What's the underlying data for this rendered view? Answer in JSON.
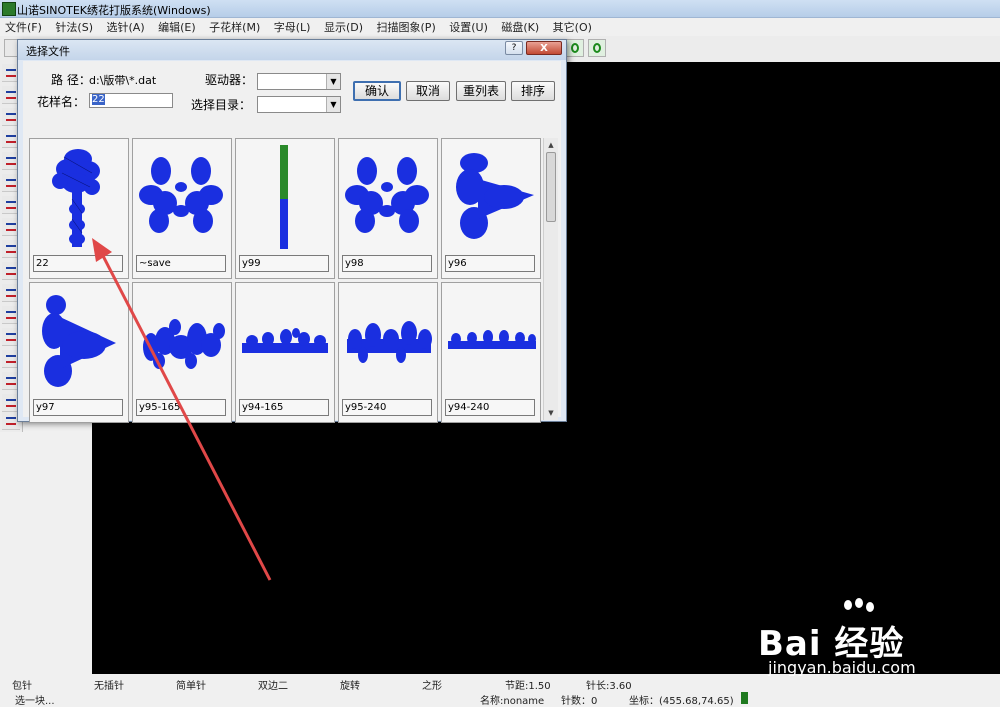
{
  "window": {
    "title": "山诺SINOTEK绣花打版系统(Windows)"
  },
  "menu": [
    "文件(F)",
    "针法(S)",
    "选针(A)",
    "编辑(E)",
    "子花样(M)",
    "字母(L)",
    "显示(D)",
    "扫描图象(P)",
    "设置(U)",
    "磁盘(K)",
    "其它(O)"
  ],
  "dialog": {
    "title": "选择文件",
    "help_label": "?",
    "close_label": "X",
    "path_label": "路 径：",
    "path_value": "d:\\版带\\*.dat",
    "name_label": "花样名：",
    "name_value": "22",
    "drive_label": "驱动器：",
    "dir_label": "选择目录：",
    "buttons": {
      "ok": "确认",
      "cancel": "取消",
      "relist": "重列表",
      "sort": "排序"
    },
    "files": [
      "22",
      "~save",
      "y99",
      "y98",
      "y96",
      "y97",
      "y95-165",
      "y94-165",
      "y95-240",
      "y94-240"
    ]
  },
  "status": {
    "items": [
      "包针",
      "无插针",
      "简单针",
      "双边二",
      "旋转",
      "之形"
    ],
    "pitch": "节距:1.50",
    "stitch_len": "针长:3.60",
    "hint": "选一块...",
    "name": "名称:noname",
    "count": "针数：0",
    "coords": "坐标：(455.68,74.65)"
  },
  "watermark": {
    "brand": "Bai 经验",
    "url": "jingyan.baidu.com"
  },
  "colors": {
    "canvas": "#000000",
    "pattern_blue": "#1a2fe0",
    "pattern_green": "#2a8a2a",
    "annotation_arrow": "#e04848"
  }
}
